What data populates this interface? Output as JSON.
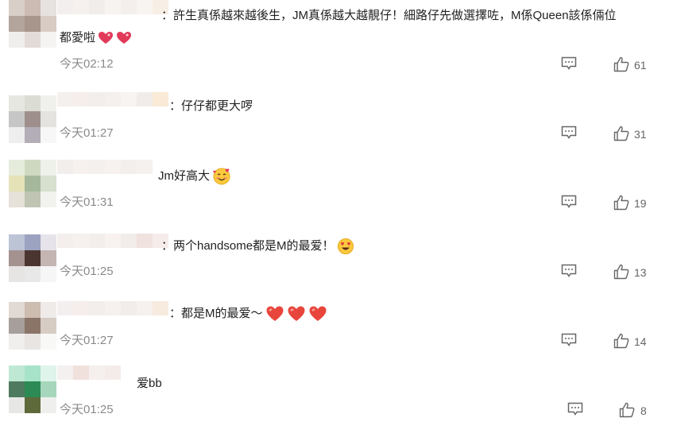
{
  "comments": [
    {
      "text_line1": "：許生真係越來越後生，JM真係越大越靚仔！細路仔先做選擇咗，M係Queen該係倆位",
      "text_line2": "都愛啦",
      "emojis": [
        "sparkle-heart-emoji",
        "sparkle-heart-emoji"
      ],
      "time": "今天02:12",
      "likes": "61"
    },
    {
      "text_line1": "：仔仔都更大啰",
      "emojis": [],
      "time": "今天01:27",
      "likes": "31"
    },
    {
      "text_line1": "Jm好高大",
      "emojis": [
        "smiling-face-with-hearts-emoji"
      ],
      "time": "今天01:31",
      "likes": "19"
    },
    {
      "text_line1": "：两个handsome都是M的最爱！",
      "emojis": [
        "heart-eyes-emoji"
      ],
      "time": "今天01:25",
      "likes": "13"
    },
    {
      "text_line1": "：都是M的最爱～",
      "emojis": [
        "red-heart-emoji",
        "red-heart-emoji",
        "red-heart-emoji"
      ],
      "time": "今天01:27",
      "likes": "14"
    },
    {
      "text_line1": "爱bb",
      "emojis": [],
      "time": "今天01:25",
      "likes": "8"
    }
  ],
  "colors": {
    "text": "#222222",
    "time": "#8a8a8a",
    "icon": "#666666",
    "heart": "#e8463c"
  }
}
